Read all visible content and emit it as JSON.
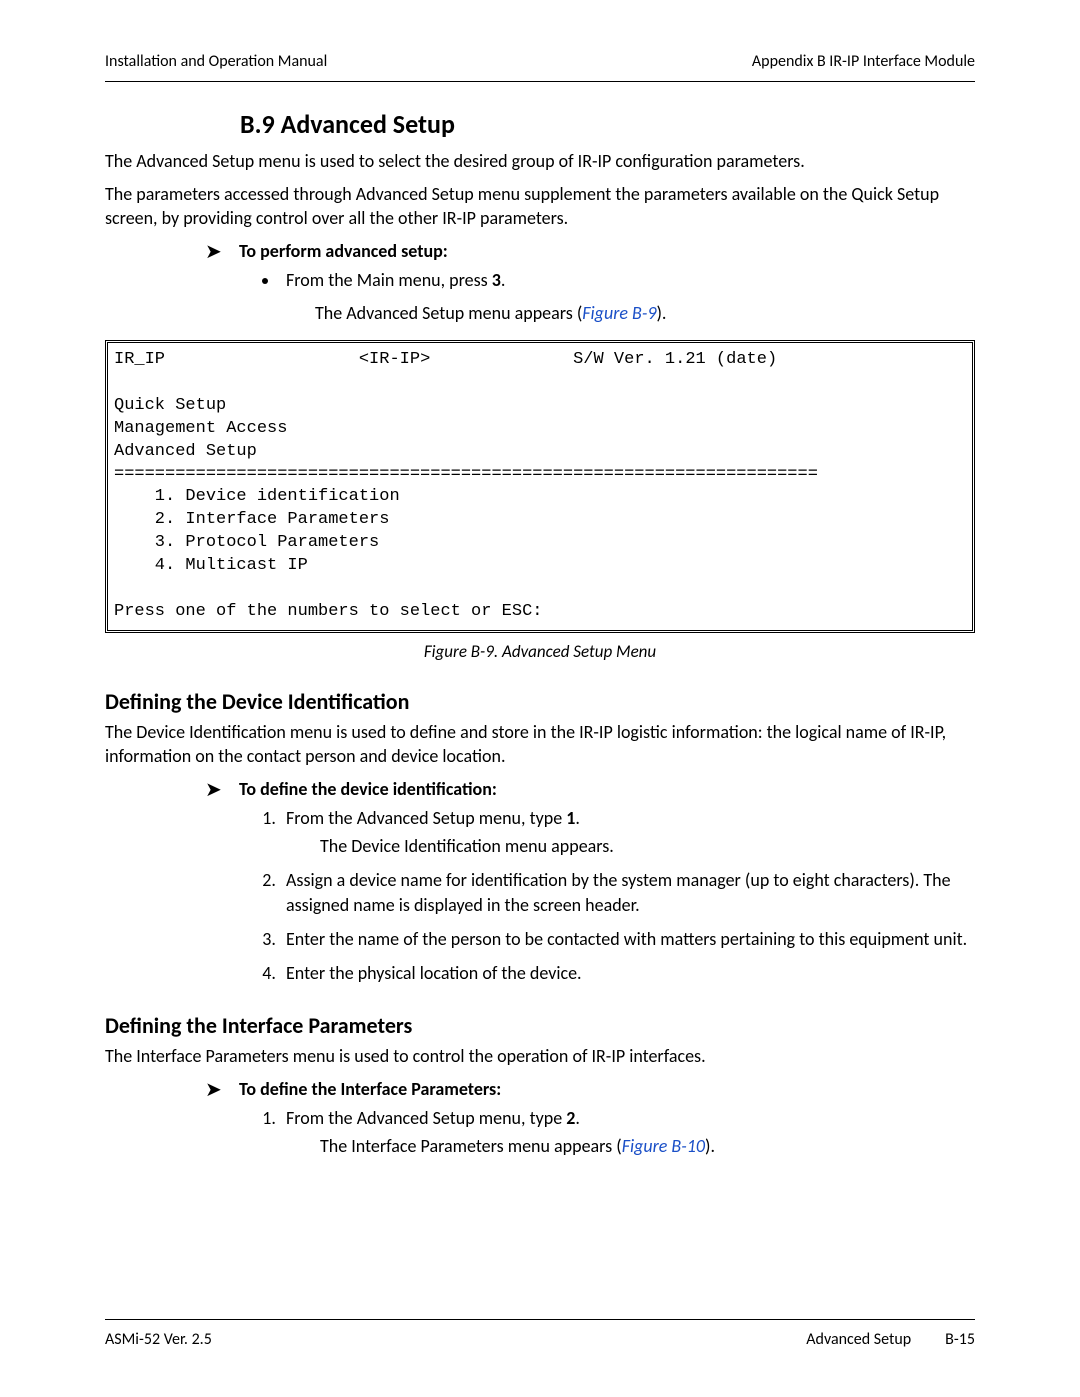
{
  "header": {
    "left": "Installation and Operation Manual",
    "right": "Appendix B  IR-IP Interface Module"
  },
  "section": {
    "number": "B.9",
    "title": "Advanced Setup",
    "p1": "The Advanced Setup menu is used to select the desired group of IR-IP configuration parameters.",
    "p2": "The parameters accessed through Advanced Setup menu supplement the parameters available on the Quick Setup screen, by providing control over all the other IR-IP parameters."
  },
  "proc1": {
    "title": "To perform advanced setup:",
    "bullet_pre": "From the Main menu, press ",
    "bullet_bold": "3",
    "bullet_post": ".",
    "sub_pre": "The Advanced Setup menu appears (",
    "sub_link": "Figure B-9",
    "sub_post": ")."
  },
  "term": {
    "line1_left": "IR_IP",
    "line1_mid": "<IR-IP>",
    "line1_right": "S/W Ver. 1.21 (date)",
    "blank": "",
    "l2": "Quick Setup",
    "l3": "Management Access",
    "l4": "Advanced Setup",
    "rule": "=====================================================================",
    "m1": "    1. Device identification",
    "m2": "    2. Interface Parameters",
    "m3": "    3. Protocol Parameters",
    "m4": "    4. Multicast IP",
    "last": "Press one of the numbers to select or ESC:"
  },
  "figcap": "Figure B-9.  Advanced Setup Menu",
  "devid": {
    "heading": "Defining the Device Identification",
    "p": "The Device Identification menu is used to define and store in the IR-IP logistic information: the logical name of IR-IP, information on the contact person and device location.",
    "proc_title": "To define the device identification:",
    "li1_pre": "From the Advanced Setup menu, type ",
    "li1_bold": "1",
    "li1_post": ".",
    "li1_sub": "The Device Identification menu appears.",
    "li2": "Assign a device name for identification by the system manager (up to eight characters). The assigned name is displayed in the screen header.",
    "li3": "Enter the name of the person to be contacted with matters pertaining to this equipment unit.",
    "li4": "Enter the physical location of the device."
  },
  "iface": {
    "heading": "Defining the Interface Parameters",
    "p": "The Interface Parameters menu is used to control the operation of IR-IP interfaces.",
    "proc_title": "To define the Interface Parameters:",
    "li1_pre": "From the Advanced Setup menu, type ",
    "li1_bold": "2",
    "li1_post": ".",
    "li1_sub_pre": "The Interface Parameters menu appears (",
    "li1_sub_link": "Figure B-10",
    "li1_sub_post": ")."
  },
  "footer": {
    "left": "ASMi-52 Ver. 2.5",
    "right_label": "Advanced Setup",
    "right_page": "B-15"
  }
}
